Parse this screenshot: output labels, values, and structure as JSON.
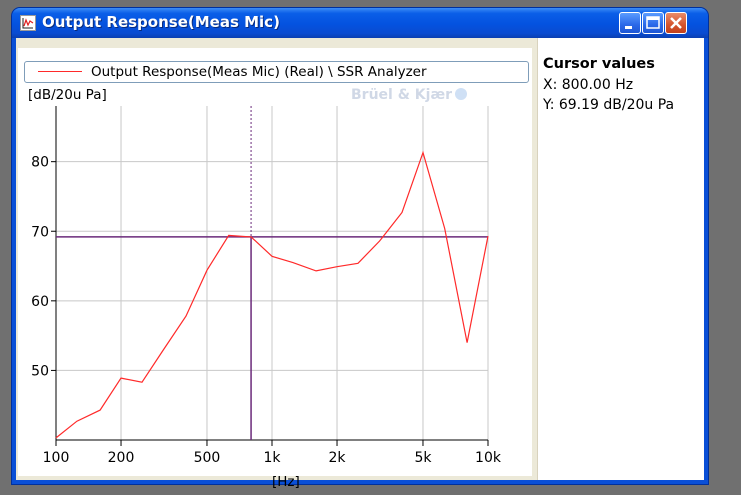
{
  "window": {
    "title": "Output Response(Meas Mic)"
  },
  "legend": {
    "label": "Output Response(Meas Mic) (Real) \\ SSR Analyzer",
    "color": "#ff2a2a"
  },
  "watermark": "Brüel & Kjær",
  "cursor_panel": {
    "title": "Cursor values",
    "x_text": "X: 800.00 Hz",
    "y_text": "Y: 69.19 dB/20u Pa"
  },
  "chart_data": {
    "type": "line",
    "ylabel": "[dB/20u Pa]",
    "xlabel": "[Hz]",
    "xscale": "log",
    "xlim": [
      100,
      10000
    ],
    "ylim": [
      40,
      88
    ],
    "x_ticks": [
      100,
      200,
      500,
      1000,
      2000,
      5000,
      10000
    ],
    "x_tick_labels": [
      "100",
      "200",
      "500",
      "1k",
      "2k",
      "5k",
      "10k"
    ],
    "y_ticks": [
      50,
      60,
      70,
      80
    ],
    "y_tick_labels": [
      "50",
      "60",
      "70",
      "80"
    ],
    "grid": true,
    "series": [
      {
        "name": "Output Response(Meas Mic) (Real) \\ SSR Analyzer",
        "color": "#ff2a2a",
        "x": [
          100,
          125,
          160,
          200,
          250,
          315,
          400,
          500,
          630,
          700,
          800,
          1000,
          1250,
          1600,
          2000,
          2500,
          3150,
          4000,
          5000,
          6300,
          8000,
          10000
        ],
        "y": [
          40.3,
          42.7,
          44.3,
          48.9,
          48.3,
          53.0,
          57.8,
          64.4,
          69.4,
          69.3,
          69.19,
          66.4,
          65.5,
          64.3,
          64.9,
          65.4,
          68.6,
          72.7,
          81.3,
          70.4,
          54.0,
          69.3
        ]
      }
    ],
    "cursor": {
      "x": 800,
      "y": 69.19,
      "h_color": "#6a2a7a",
      "v_color": "#6a2a7a"
    }
  }
}
